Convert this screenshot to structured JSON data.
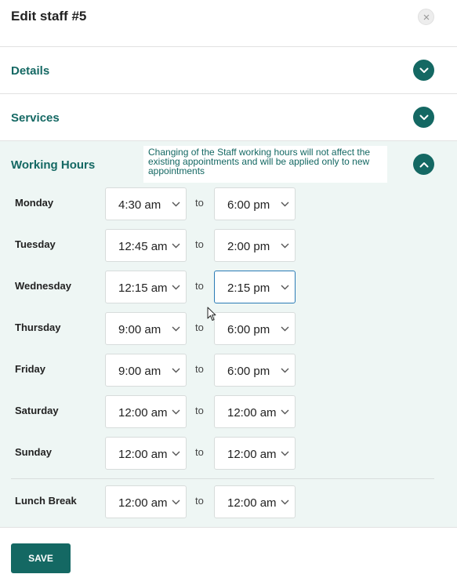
{
  "header": {
    "title": "Edit staff #5"
  },
  "sections": {
    "details": {
      "title": "Details"
    },
    "services": {
      "title": "Services"
    },
    "working_hours": {
      "title": "Working Hours",
      "notice": "Changing of the Staff working hours will not affect the existing appointments and will be applied only to new appointments",
      "to_label": "to",
      "days": [
        {
          "label": "Monday",
          "from": "4:30 am",
          "to": "6:00 pm"
        },
        {
          "label": "Tuesday",
          "from": "12:45 am",
          "to": "2:00 pm"
        },
        {
          "label": "Wednesday",
          "from": "12:15 am",
          "to": "2:15 pm"
        },
        {
          "label": "Thursday",
          "from": "9:00 am",
          "to": "6:00 pm"
        },
        {
          "label": "Friday",
          "from": "9:00 am",
          "to": "6:00 pm"
        },
        {
          "label": "Saturday",
          "from": "12:00 am",
          "to": "12:00 am"
        },
        {
          "label": "Sunday",
          "from": "12:00 am",
          "to": "12:00 am"
        }
      ],
      "lunch_break": {
        "label": "Lunch Break",
        "from": "12:00 am",
        "to": "12:00 am"
      }
    }
  },
  "footer": {
    "save_label": "SAVE"
  },
  "colors": {
    "accent": "#146863",
    "focus_border": "#2a7bb5",
    "section_bg": "#eef6f4"
  },
  "icons": {
    "close": "close-icon",
    "expand": "chevron-down-icon",
    "collapse": "chevron-up-icon",
    "select_caret": "chevron-down-icon"
  }
}
